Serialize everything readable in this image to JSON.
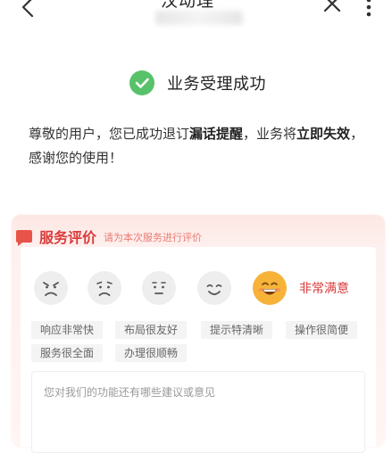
{
  "header": {
    "title": "汉动理",
    "subtitle": "********"
  },
  "success": {
    "text": "业务受理成功"
  },
  "notice": {
    "part1": "尊敬的用户，您已成功退订",
    "strong1": "漏话提醒",
    "part2": "，业务将",
    "strong2": "立即失效",
    "part3": "，感谢您的使用！"
  },
  "evaluation": {
    "title": "服务评价",
    "hint": "请为本次服务进行评价",
    "rating_text": "非常满意",
    "selected_rating": 5,
    "max_rating": 5,
    "tags": [
      "响应非常快",
      "布局很友好",
      "提示特清晰",
      "操作很简便",
      "服务很全面",
      "办理很顺畅"
    ],
    "input_placeholder": "您对我们的功能还有哪些建议或意见"
  },
  "colors": {
    "accent": "#d93b3a",
    "success": "#57c26a",
    "selected_face": "#f6b338"
  }
}
